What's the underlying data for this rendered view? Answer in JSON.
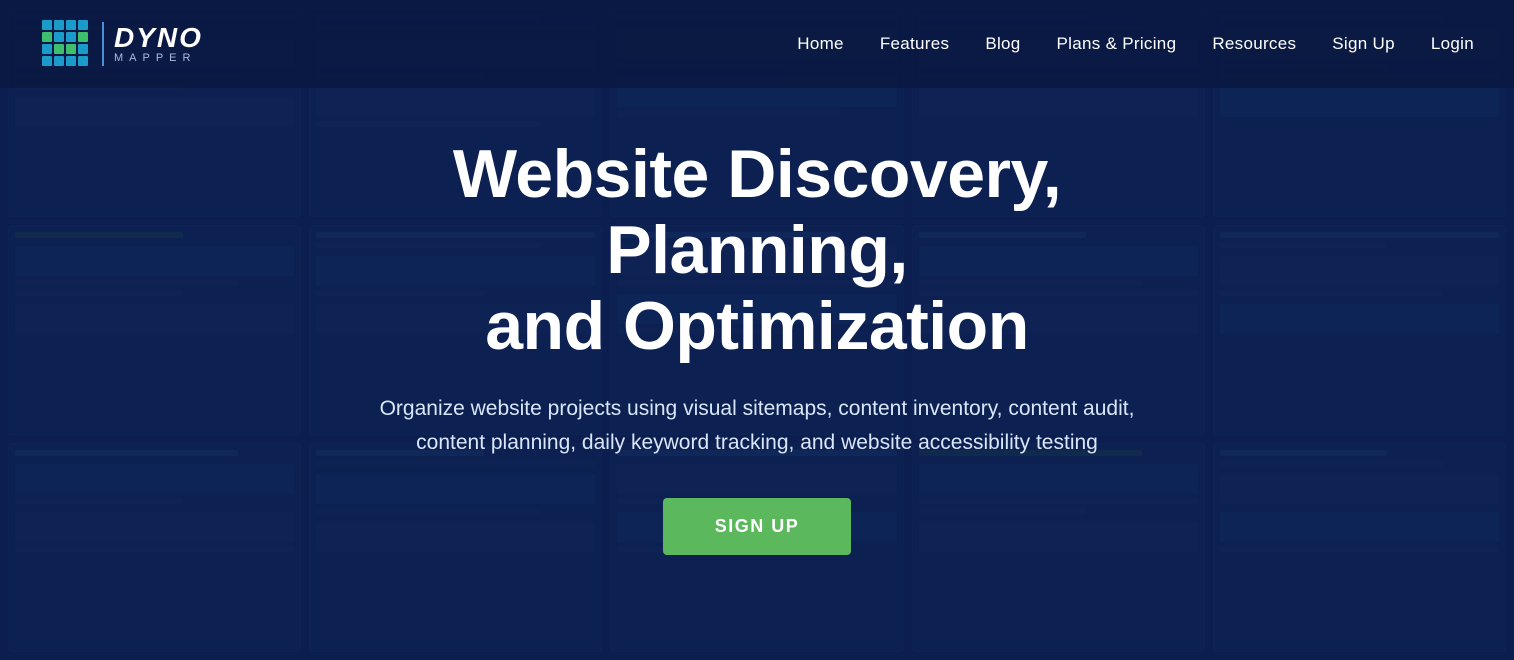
{
  "nav": {
    "brand": "DYNO",
    "brand_sub": "MAPPER",
    "brand_reg": "®",
    "links": [
      {
        "label": "Home",
        "id": "home"
      },
      {
        "label": "Features",
        "id": "features"
      },
      {
        "label": "Blog",
        "id": "blog"
      },
      {
        "label": "Plans & Pricing",
        "id": "plans-pricing"
      },
      {
        "label": "Resources",
        "id": "resources"
      },
      {
        "label": "Sign Up",
        "id": "sign-up"
      },
      {
        "label": "Login",
        "id": "login"
      }
    ]
  },
  "hero": {
    "title_line1": "Website Discovery, Planning,",
    "title_line2": "and Optimization",
    "subtitle": "Organize website projects using visual sitemaps, content inventory, content audit, content planning, daily keyword tracking, and website accessibility testing",
    "cta_label": "SIGN UP"
  },
  "colors": {
    "bg_dark": "#0d2a5e",
    "accent_blue": "#1e6bb8",
    "accent_green": "#5cb85c",
    "text_white": "#ffffff",
    "text_light": "#d8e6f7"
  }
}
